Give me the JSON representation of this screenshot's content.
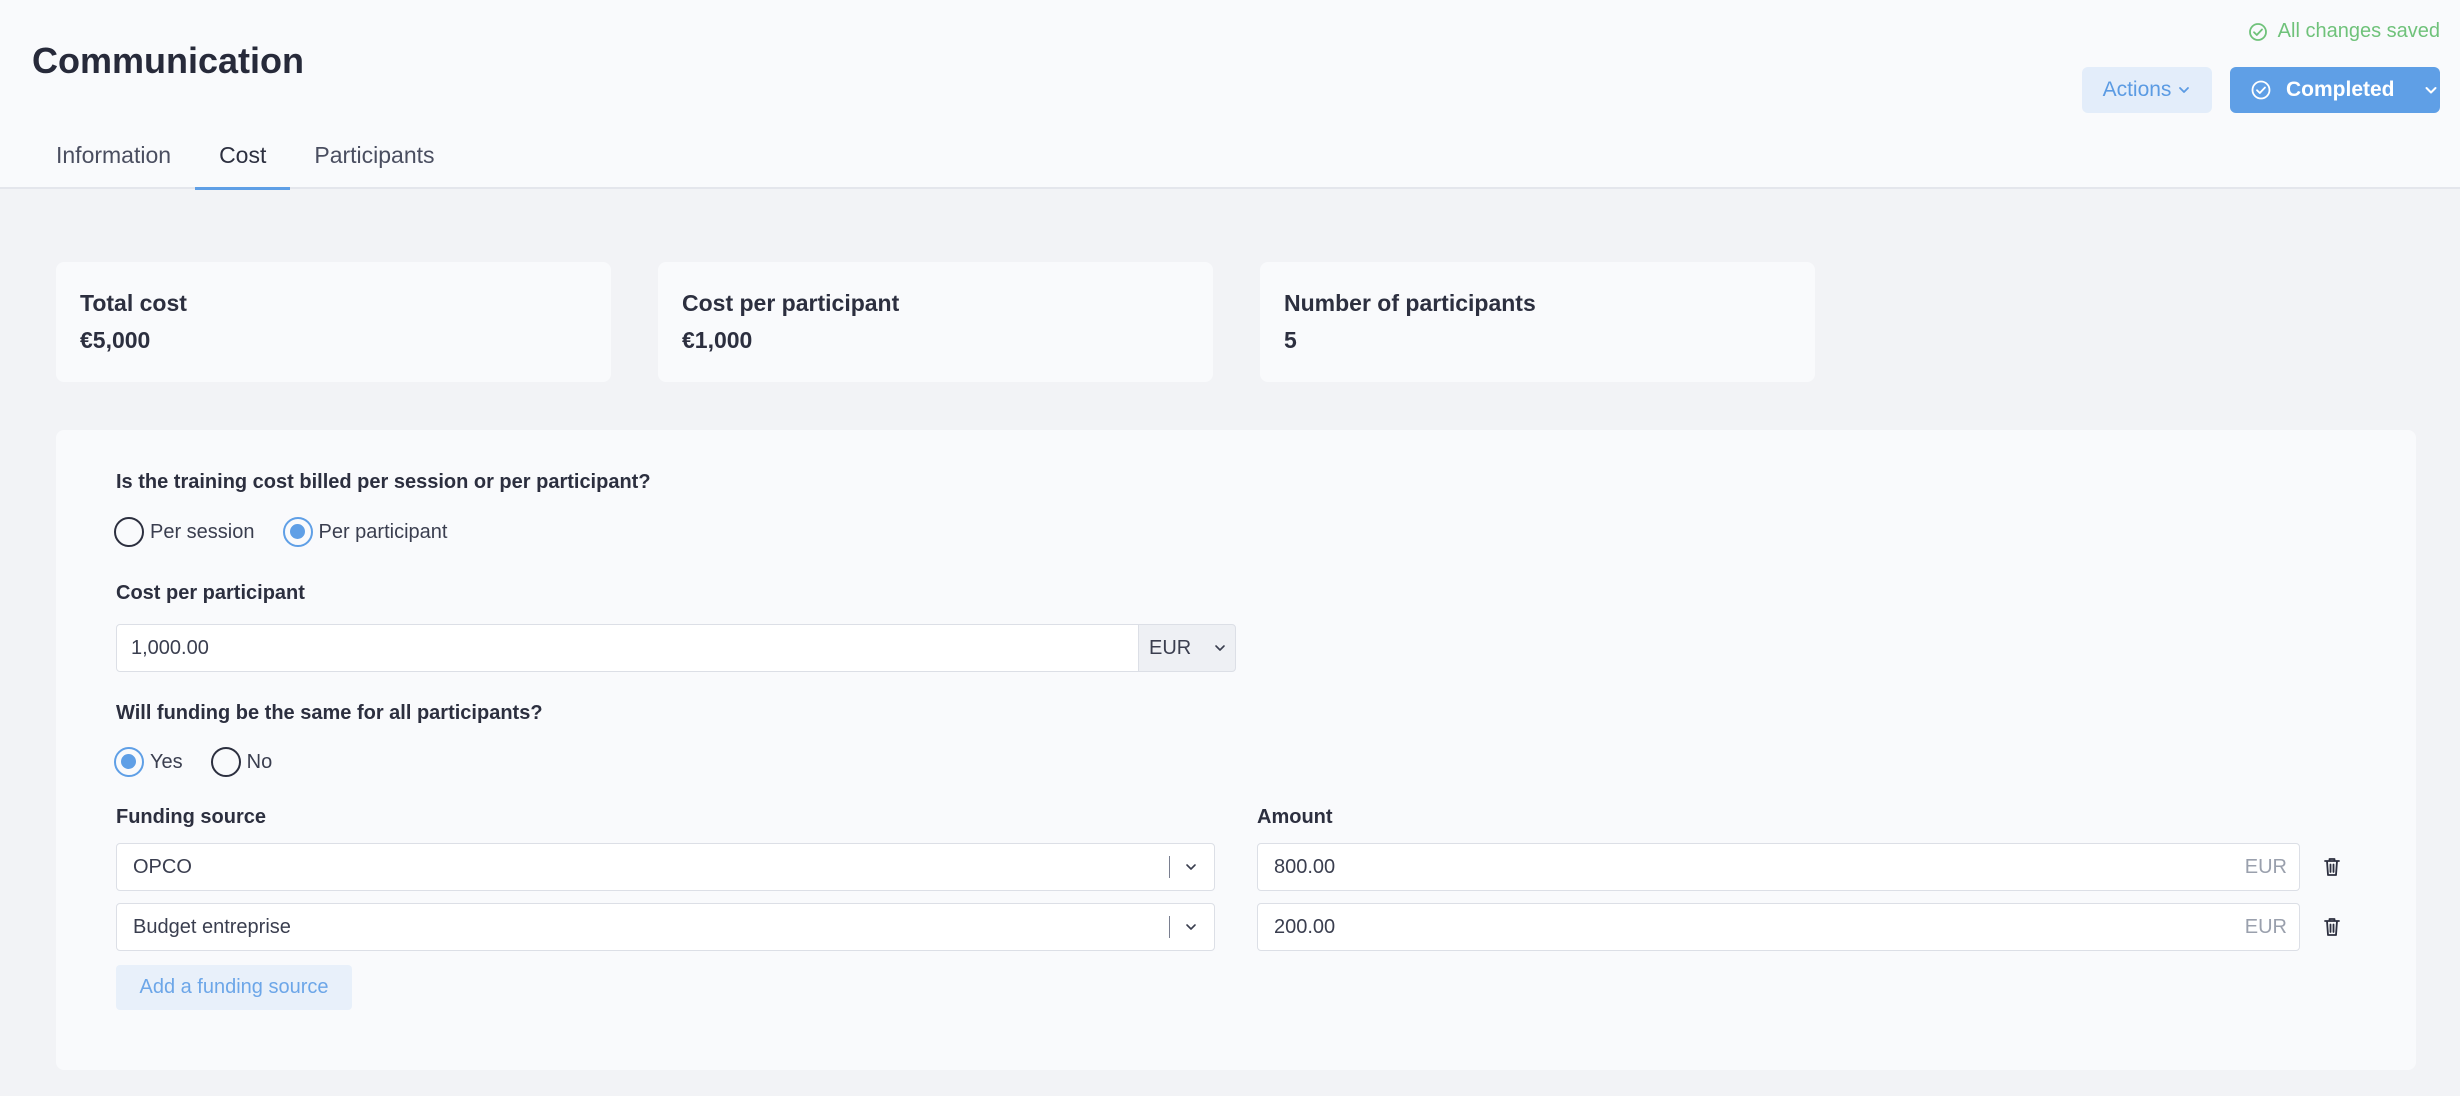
{
  "header": {
    "title": "Communication",
    "saved_status": "All changes saved",
    "actions_label": "Actions",
    "completed_label": "Completed"
  },
  "tabs": [
    {
      "label": "Information"
    },
    {
      "label": "Cost"
    },
    {
      "label": "Participants"
    }
  ],
  "active_tab": "Cost",
  "stats": [
    {
      "label": "Total cost",
      "value": "€5,000"
    },
    {
      "label": "Cost per participant",
      "value": "€1,000"
    },
    {
      "label": "Number of participants",
      "value": "5"
    }
  ],
  "form": {
    "billing_question": "Is the training cost billed per session or per participant?",
    "billing_options": [
      {
        "label": "Per session",
        "selected": false
      },
      {
        "label": "Per participant",
        "selected": true
      }
    ],
    "cost_label": "Cost per participant",
    "cost_value": "1,000.00",
    "currency": "EUR",
    "funding_question": "Will funding be the same for all participants?",
    "funding_options": [
      {
        "label": "Yes",
        "selected": true
      },
      {
        "label": "No",
        "selected": false
      }
    ],
    "funding_source_header": "Funding source",
    "amount_header": "Amount",
    "funding_rows": [
      {
        "source": "OPCO",
        "amount": "800.00",
        "unit": "EUR"
      },
      {
        "source": "Budget entreprise",
        "amount": "200.00",
        "unit": "EUR"
      }
    ],
    "add_funding_label": "Add a funding source"
  },
  "colors": {
    "accent": "#5f9fe6",
    "success": "#6fc27a",
    "text": "#2c2f3f"
  },
  "icons": {
    "saved": "check-circle-icon",
    "dropdown": "chevron-down-icon",
    "delete": "trash-icon"
  }
}
